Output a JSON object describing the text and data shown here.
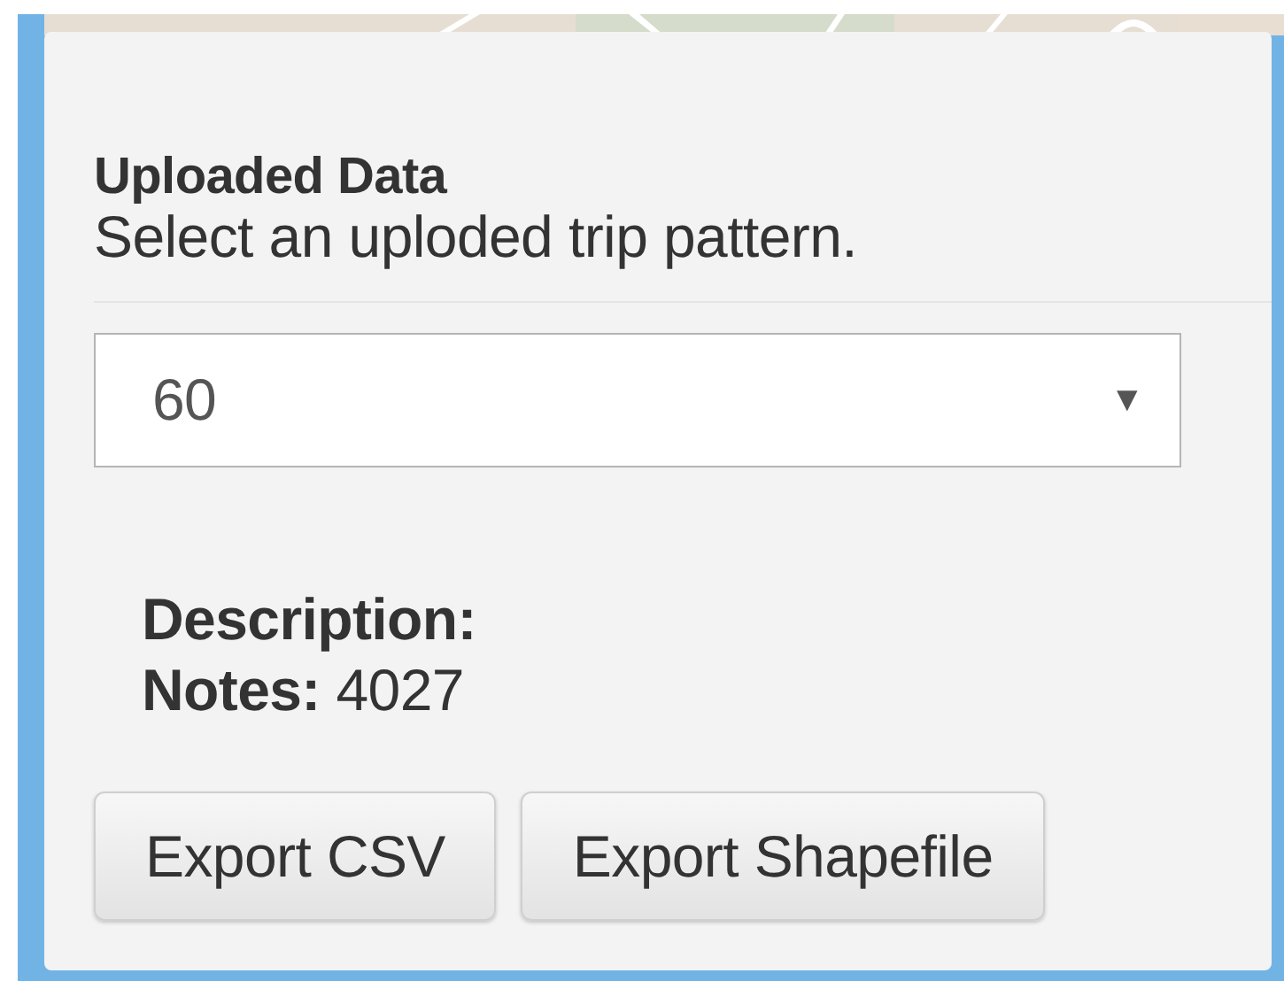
{
  "panel": {
    "title": "Uploaded Data",
    "subtitle": "Select an uploded trip pattern."
  },
  "select": {
    "value": "60",
    "arrow": "▼"
  },
  "details": [
    {
      "label": "Description:"
    },
    {
      "label": "Notes:",
      "value": "4027"
    }
  ],
  "buttons": [
    "Export CSV",
    "Export Shapefile"
  ]
}
